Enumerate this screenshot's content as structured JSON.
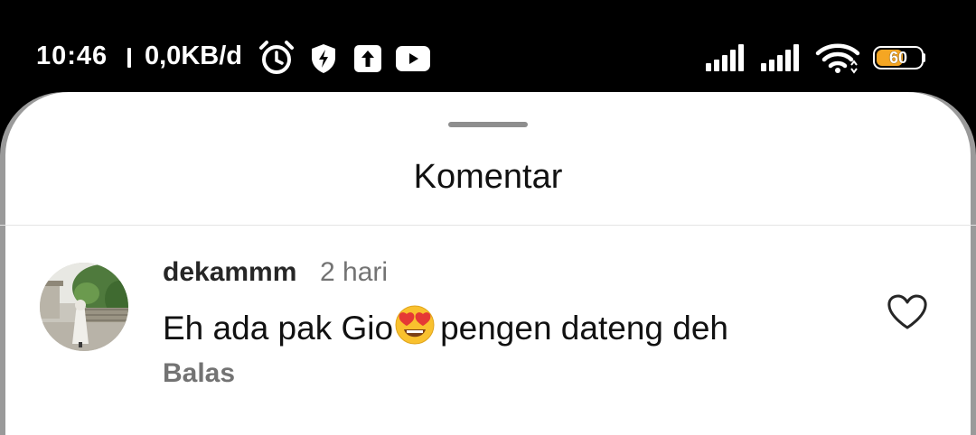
{
  "status_bar": {
    "time": "10:46",
    "net_speed": "0,0KB/d",
    "battery_level": "60",
    "battery_color": "#f5a623",
    "icons": [
      "alarm-icon",
      "shield-bolt-icon",
      "upload-icon",
      "youtube-icon",
      "signal-icon",
      "signal-icon",
      "wifi-icon",
      "battery-icon"
    ]
  },
  "sheet": {
    "title": "Komentar"
  },
  "comment": {
    "username": "dekammm",
    "time_ago": "2 hari",
    "text_before": "Eh ada pak Gio",
    "emoji": "heart-eyes-emoji",
    "text_after": "pengen dateng deh",
    "reply_label": "Balas",
    "like_icon": "heart-outline-icon"
  }
}
